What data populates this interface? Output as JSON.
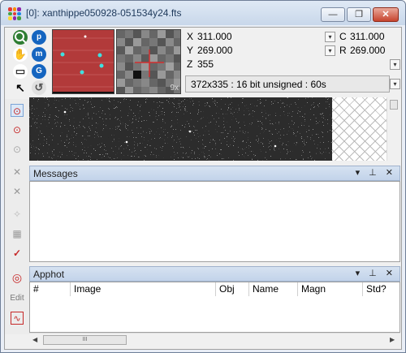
{
  "window": {
    "title": "[0]: xanthippe050928-051534y24.fts",
    "buttons": {
      "minimize": "—",
      "maximize": "❐",
      "close": "✕"
    }
  },
  "tools": [
    {
      "name": "zoom-tool",
      "glyph": "",
      "color": "#2e7d32"
    },
    {
      "name": "p-tool",
      "glyph": "p",
      "color": "#1565c0"
    },
    {
      "name": "pan-tool",
      "glyph": "✋",
      "color": "#333333"
    },
    {
      "name": "m-tool",
      "glyph": "m",
      "color": "#1565c0"
    },
    {
      "name": "frame-tool",
      "glyph": "▭",
      "color": "#333333"
    },
    {
      "name": "g-tool",
      "glyph": "G",
      "color": "#1565c0"
    },
    {
      "name": "pointer-tool",
      "glyph": "↖",
      "color": "#000000"
    },
    {
      "name": "rotate-tool",
      "glyph": "↺",
      "color": "#555555"
    }
  ],
  "coords": {
    "x_label": "X",
    "x_value": "311.000",
    "y_label": "Y",
    "y_value": "269.000",
    "z_label": "Z",
    "z_value": "355",
    "c_label": "C",
    "c_value": "311.000",
    "r_label": "R",
    "r_value": "269.000",
    "zoom_badge": "9x",
    "info": "372x335 : 16 bit unsigned : 60s"
  },
  "side_tools": [
    {
      "name": "target-tool",
      "glyph": "⊙",
      "color": "#c62828",
      "active": true
    },
    {
      "name": "target-star-tool",
      "glyph": "⊙",
      "color": "#c62828"
    },
    {
      "name": "target-gray-tool",
      "glyph": "⊙",
      "color": "#aaaaaa"
    },
    {
      "name": "x-tool",
      "glyph": "✕",
      "color": "#999999"
    },
    {
      "name": "x-sub-tool",
      "glyph": "✕",
      "color": "#999999"
    },
    {
      "name": "sparkle-tool",
      "glyph": "✧",
      "color": "#bbbbbb"
    },
    {
      "name": "calc-tool",
      "glyph": "▦",
      "color": "#999999"
    },
    {
      "name": "check-tool",
      "glyph": "✓",
      "color": "#c62828"
    },
    {
      "name": "bullseye-tool",
      "glyph": "◎",
      "color": "#c62828"
    },
    {
      "name": "edit-label",
      "glyph": "Edit",
      "color": "#777777"
    },
    {
      "name": "graph-tool",
      "glyph": "∿",
      "color": "#c62828"
    }
  ],
  "panels": {
    "messages": {
      "title": "Messages",
      "controls": "▾ ⊥ ✕"
    },
    "apphot": {
      "title": "Apphot",
      "controls": "▾ ⊥ ✕",
      "columns": [
        "#",
        "Image",
        "Obj",
        "Name",
        "Magn",
        "Std?"
      ]
    }
  },
  "scrollbar": {
    "thumb_label": "III"
  }
}
